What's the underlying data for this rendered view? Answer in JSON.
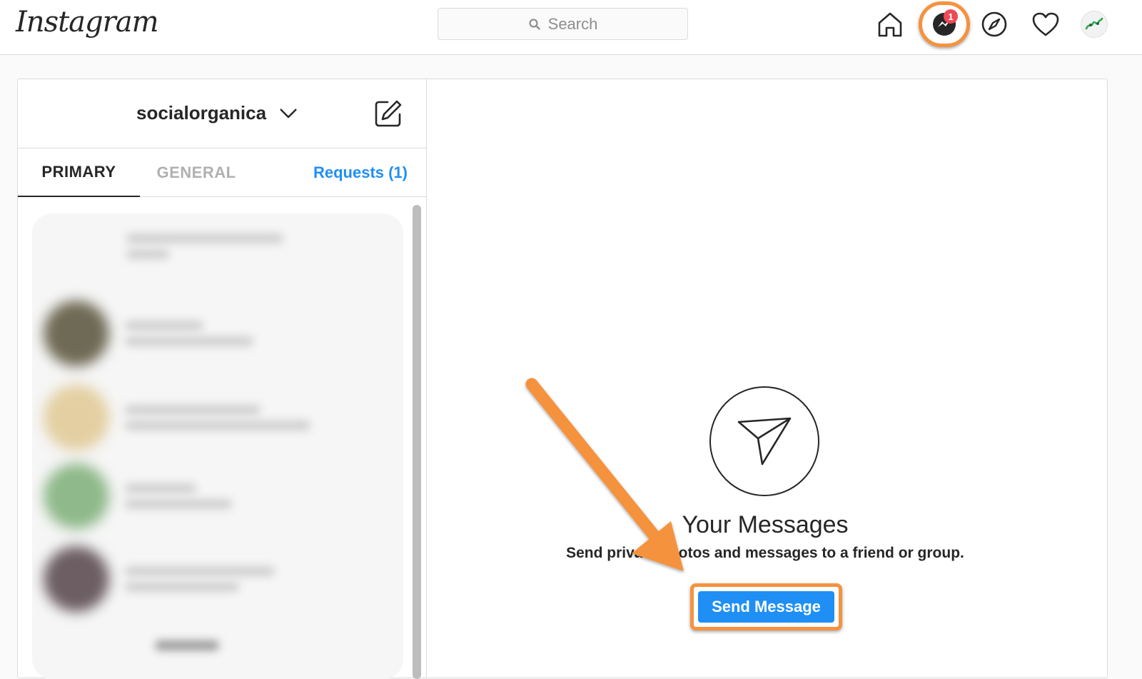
{
  "brand": {
    "logo_text": "Instagram"
  },
  "search": {
    "placeholder": "Search"
  },
  "nav": {
    "icons": [
      "home-icon",
      "messenger-icon",
      "explore-icon",
      "heart-icon",
      "profile-avatar"
    ],
    "messenger_badge": "1"
  },
  "sidebar": {
    "account_name": "socialorganica",
    "tabs": [
      {
        "label": "PRIMARY",
        "active": true
      },
      {
        "label": "GENERAL",
        "active": false
      },
      {
        "label": "Requests (1)",
        "active": false
      }
    ]
  },
  "main": {
    "title": "Your Messages",
    "subtitle": "Send private photos and messages to a friend or group.",
    "send_button": "Send Message"
  },
  "colors": {
    "accent_blue": "#1f8ff5",
    "highlight_orange": "#f5923e",
    "badge_red": "#ed4956",
    "border": "#dbdbdb"
  }
}
